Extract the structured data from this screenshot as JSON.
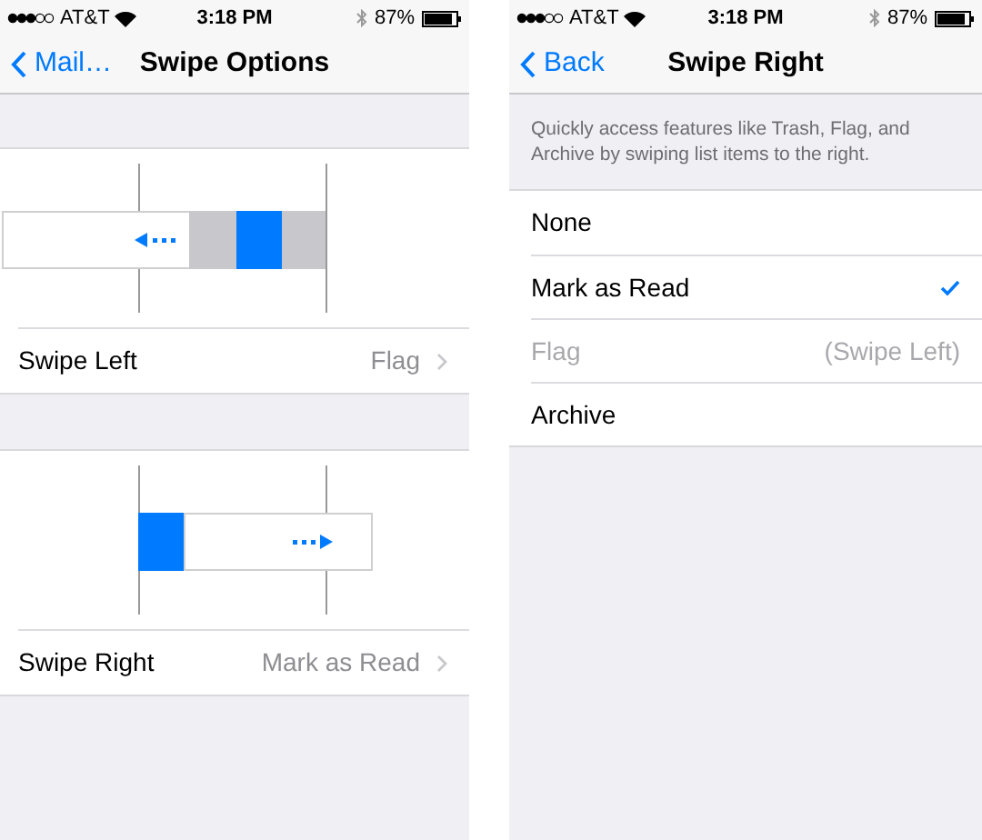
{
  "screens": [
    {
      "status": {
        "carrier": "AT&T",
        "time": "3:18 PM",
        "battery": "87%"
      },
      "nav": {
        "back": "Mail…",
        "title": "Swipe Options"
      },
      "sections": [
        {
          "kind": "left",
          "label": "Swipe Left",
          "value": "Flag"
        },
        {
          "kind": "right",
          "label": "Swipe Right",
          "value": "Mark as Read"
        }
      ]
    },
    {
      "status": {
        "carrier": "AT&T",
        "time": "3:18 PM",
        "battery": "87%"
      },
      "nav": {
        "back": "Back",
        "title": "Swipe Right"
      },
      "description": "Quickly access features like Trash, Flag, and Archive by swiping list items to the right.",
      "options": [
        {
          "label": "None",
          "selected": false,
          "disabled": false
        },
        {
          "label": "Mark as Read",
          "selected": true,
          "disabled": false
        },
        {
          "label": "Flag",
          "selected": false,
          "disabled": true,
          "note": "(Swipe Left)"
        },
        {
          "label": "Archive",
          "selected": false,
          "disabled": false
        }
      ]
    }
  ]
}
